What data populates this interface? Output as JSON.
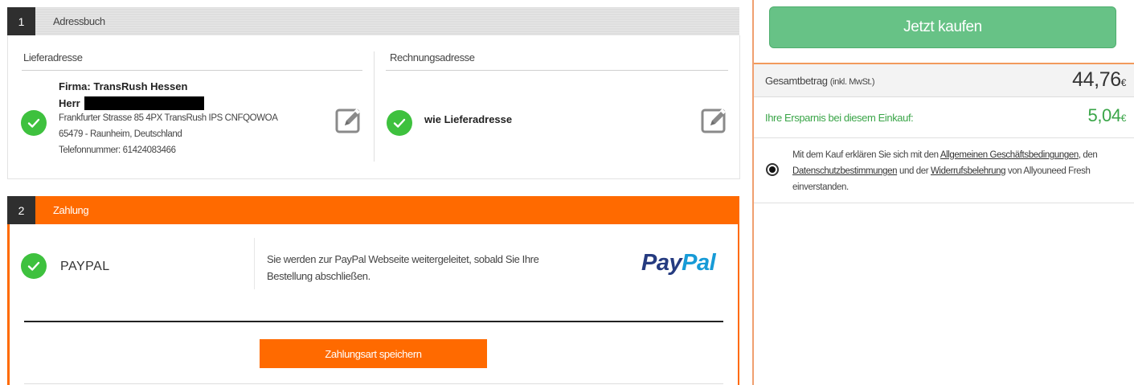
{
  "step1": {
    "number": "1",
    "title": "Adressbuch",
    "shipping": {
      "heading": "Lieferadresse",
      "company": "Firma: TransRush Hessen",
      "salutation": "Herr",
      "street": "Frankfurter Strasse 85 4PX TransRush IPS CNFQOWOA",
      "city": "65479 - Raunheim, Deutschland",
      "phone": "Telefonnummer: 61424083466"
    },
    "billing": {
      "heading": "Rechnungsadresse",
      "text": "wie Lieferadresse"
    }
  },
  "step2": {
    "number": "2",
    "title": "Zahlung",
    "method": "PAYPAL",
    "description": "Sie werden zur PayPal Webseite weitergeleitet, sobald Sie Ihre Bestellung abschließen.",
    "logo_text_1": "Pay",
    "logo_text_2": "Pal",
    "save_button": "Zahlungsart speichern"
  },
  "summary": {
    "buy_button": "Jetzt kaufen",
    "total_label": "Gesamtbetrag",
    "total_note": "(inkl. MwSt.)",
    "total_main": "44,76",
    "total_currency": "€",
    "savings_label": "Ihre Ersparnis bei diesem Einkauf:",
    "savings_main": "5,04",
    "savings_currency": "€",
    "terms_prefix": "Mit dem Kauf erklären Sie sich mit den",
    "terms_link1": "Allgemeinen Geschäftsbedingungen",
    "terms_mid1": ", den",
    "terms_link2": "Datenschutzbestimmungen",
    "terms_mid2": "und der",
    "terms_link3": "Widerrufsbelehrung",
    "terms_mid3": "von Allyouneed Fresh",
    "terms_suffix": "einverstanden."
  },
  "colors": {
    "accent_orange": "#ff6a00",
    "success_green": "#3ec13e",
    "buy_green": "#67c286",
    "savings_green": "#3aa548",
    "paypal_dark": "#253b80",
    "paypal_light": "#179bd7"
  },
  "icons": [
    "check-icon",
    "edit-icon",
    "radio-selected-icon"
  ]
}
